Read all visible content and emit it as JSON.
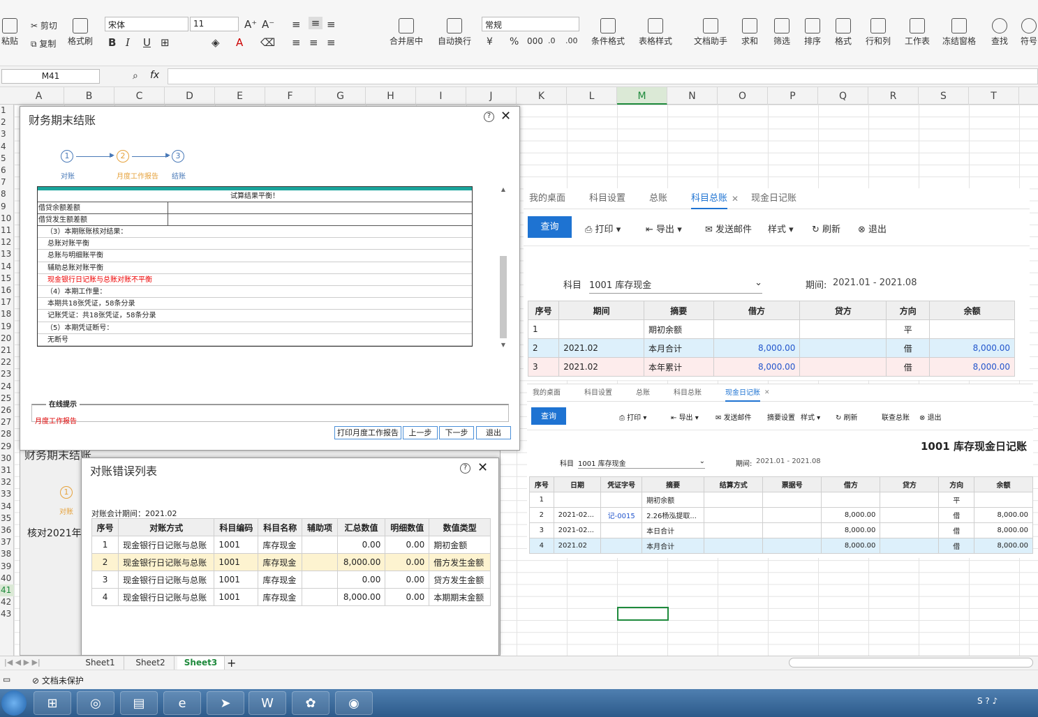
{
  "ribbon": {
    "paste": "粘贴",
    "cut": "剪切",
    "copy": "复制",
    "format_painter": "格式刷",
    "font_name": "宋体",
    "font_size": "11",
    "number_format": "常规",
    "merge_center": "合并居中",
    "auto_wrap": "自动换行",
    "cond_format": "条件格式",
    "table_style": "表格样式",
    "doc_assistant": "文档助手",
    "sum": "求和",
    "filter": "筛选",
    "sort": "排序",
    "format": "格式",
    "row_col": "行和列",
    "worksheet": "工作表",
    "freeze": "冻结窗格",
    "find": "查找",
    "symbol": "符号"
  },
  "formula_bar": {
    "cell_ref": "M41",
    "fx": "fx"
  },
  "columns": [
    "A",
    "B",
    "C",
    "D",
    "E",
    "F",
    "G",
    "H",
    "I",
    "J",
    "K",
    "L",
    "M",
    "N",
    "O",
    "P",
    "Q",
    "R",
    "S",
    "T"
  ],
  "rows": [
    "1",
    "2",
    "3",
    "4",
    "5",
    "6",
    "7",
    "8",
    "9",
    "10",
    "11",
    "12",
    "13",
    "14",
    "15",
    "16",
    "17",
    "18",
    "19",
    "20",
    "21",
    "22",
    "23",
    "24",
    "25",
    "26",
    "27",
    "28",
    "29",
    "30",
    "31",
    "32",
    "33",
    "34",
    "35",
    "36",
    "37",
    "38",
    "39",
    "40",
    "41",
    "42",
    "43"
  ],
  "dialog1": {
    "title": "财务期末结账",
    "steps": [
      {
        "num": "1",
        "label": "对账"
      },
      {
        "num": "2",
        "label": "月度工作报告"
      },
      {
        "num": "3",
        "label": "结账"
      }
    ],
    "report_header": "试算结果平衡！",
    "report_rows": [
      "借贷余额差额",
      "借贷发生额差额"
    ],
    "report_lines": [
      {
        "text": "（3）本期账账核对结果：",
        "red": false
      },
      {
        "text": "总账对账平衡",
        "red": false
      },
      {
        "text": "总账与明细账平衡",
        "red": false
      },
      {
        "text": "辅助总账对账平衡",
        "red": false
      },
      {
        "text": "现金银行日记账与总账对账不平衡",
        "red": true
      },
      {
        "text": "（4）本期工作量：",
        "red": false
      },
      {
        "text": "本期共18张凭证，58条分录",
        "red": false
      },
      {
        "text": "记账凭证：共18张凭证，58条分录",
        "red": false
      },
      {
        "text": "（5）本期凭证断号：",
        "red": false
      },
      {
        "text": "无断号",
        "red": false
      }
    ],
    "hint_title": "在线提示",
    "hint_text": "月度工作报告",
    "buttons": [
      "打印月度工作报告",
      "上一步",
      "下一步",
      "退出"
    ]
  },
  "dialog1_back": {
    "title": "财务期末结账",
    "step_num": "1",
    "step_label": "对账",
    "text": "核对2021年"
  },
  "dialog2": {
    "title": "对账错误列表",
    "period": "对账会计期间：2021.02",
    "headers": [
      "序号",
      "对账方式",
      "科目编码",
      "科目名称",
      "辅助项",
      "汇总数值",
      "明细数值",
      "数值类型"
    ],
    "rows": [
      [
        "1",
        "现金银行日记账与总账",
        "1001",
        "库存现金",
        "",
        "0.00",
        "0.00",
        "期初金额"
      ],
      [
        "2",
        "现金银行日记账与总账",
        "1001",
        "库存现金",
        "",
        "8,000.00",
        "0.00",
        "借方发生金额"
      ],
      [
        "3",
        "现金银行日记账与总账",
        "1001",
        "库存现金",
        "",
        "0.00",
        "0.00",
        "贷方发生金额"
      ],
      [
        "4",
        "现金银行日记账与总账",
        "1001",
        "库存现金",
        "",
        "8,000.00",
        "0.00",
        "本期期末金额"
      ]
    ]
  },
  "panel1": {
    "tabs": [
      "我的桌面",
      "科目设置",
      "总账",
      "科目总账",
      "现金日记账"
    ],
    "active_tab": 3,
    "toolbar": [
      "查询",
      "打印",
      "导出",
      "发送邮件",
      "样式",
      "刷新",
      "退出"
    ],
    "subject_label": "科目",
    "subject_value": "1001 库存现金",
    "period_label": "期间:",
    "period_value": "2021.01 - 2021.08",
    "headers": [
      "序号",
      "期间",
      "摘要",
      "借方",
      "贷方",
      "方向",
      "余额"
    ],
    "rows": [
      [
        "1",
        "",
        "期初余额",
        "",
        "",
        "平",
        ""
      ],
      [
        "2",
        "2021.02",
        "本月合计",
        "8,000.00",
        "",
        "借",
        "8,000.00"
      ],
      [
        "3",
        "2021.02",
        "本年累计",
        "8,000.00",
        "",
        "借",
        "8,000.00"
      ]
    ]
  },
  "panel2": {
    "tabs": [
      "我的桌面",
      "科目设置",
      "总账",
      "科目总账",
      "现金日记账"
    ],
    "active_tab": 4,
    "toolbar": [
      "查询",
      "打印",
      "导出",
      "发送邮件",
      "摘要设置",
      "样式",
      "刷新",
      "联查总账",
      "退出"
    ],
    "title": "1001 库存现金日记账",
    "subject_label": "科目",
    "subject_value": "1001 库存现金",
    "period_label": "期间:",
    "period_value": "2021.01 - 2021.08",
    "headers": [
      "序号",
      "日期",
      "凭证字号",
      "摘要",
      "结算方式",
      "票据号",
      "借方",
      "贷方",
      "方向",
      "余额"
    ],
    "rows": [
      [
        "1",
        "",
        "",
        "期初余额",
        "",
        "",
        "",
        "",
        "平",
        ""
      ],
      [
        "2",
        "2021-02...",
        "记-0015",
        "2.26杨泓提取...",
        "",
        "",
        "8,000.00",
        "",
        "借",
        "8,000.00"
      ],
      [
        "3",
        "2021-02...",
        "",
        "本日合计",
        "",
        "",
        "8,000.00",
        "",
        "借",
        "8,000.00"
      ],
      [
        "4",
        "2021.02",
        "",
        "本月合计",
        "",
        "",
        "8,000.00",
        "",
        "借",
        "8,000.00"
      ]
    ]
  },
  "sheets": [
    "Sheet1",
    "Sheet2",
    "Sheet3"
  ],
  "active_sheet": 2,
  "status": {
    "protect": "文档未保护"
  }
}
